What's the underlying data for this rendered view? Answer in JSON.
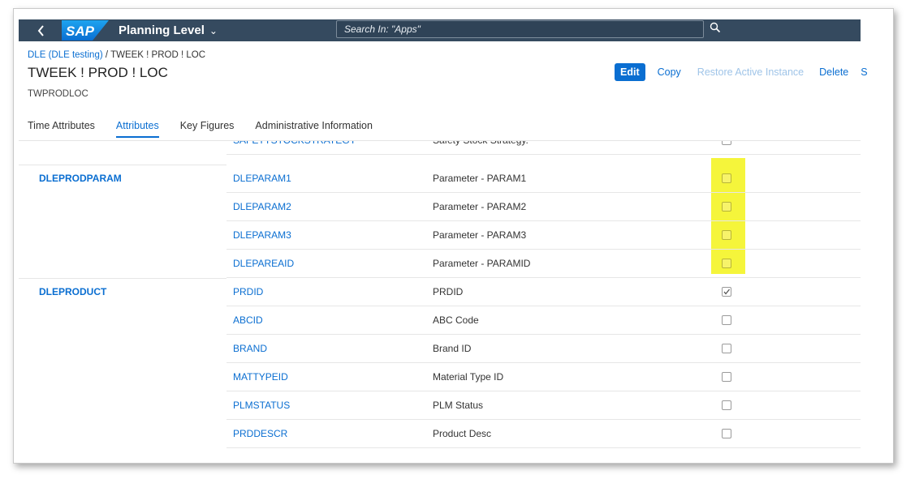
{
  "shell": {
    "back_icon": "chevron-left-icon",
    "logo_text": "SAP",
    "app_title": "Planning Level",
    "app_title_chevron": "chevron-down-icon",
    "search_placeholder": "Search In: \"Apps\"",
    "search_icon": "search-icon"
  },
  "header": {
    "breadcrumb_link": "DLE (DLE testing)",
    "breadcrumb_separator": " / ",
    "breadcrumb_current": "TWEEK ! PROD ! LOC",
    "title": "TWEEK ! PROD ! LOC",
    "subtitle": "TWPRODLOC"
  },
  "actions": {
    "edit": "Edit",
    "copy": "Copy",
    "restore": "Restore Active Instance",
    "delete": "Delete",
    "overflow_partial": "S"
  },
  "tabs": [
    {
      "label": "Time Attributes",
      "active": false
    },
    {
      "label": "Attributes",
      "active": true
    },
    {
      "label": "Key Figures",
      "active": false
    },
    {
      "label": "Administrative Information",
      "active": false
    }
  ],
  "rows": [
    {
      "group": "",
      "attribute": "SAFETYSTOCKSTRATEGY",
      "description": "Safety Stock Strategy.",
      "checked": false
    },
    {
      "group": "DLEPRODPARAM",
      "attribute": "DLEPARAM1",
      "description": "Parameter - PARAM1",
      "checked": false
    },
    {
      "group": "",
      "attribute": "DLEPARAM2",
      "description": "Parameter - PARAM2",
      "checked": false
    },
    {
      "group": "",
      "attribute": "DLEPARAM3",
      "description": "Parameter - PARAM3",
      "checked": false
    },
    {
      "group": "",
      "attribute": "DLEPAREAID",
      "description": "Parameter - PARAMID",
      "checked": false
    },
    {
      "group": "DLEPRODUCT",
      "attribute": "PRDID",
      "description": "PRDID",
      "checked": true
    },
    {
      "group": "",
      "attribute": "ABCID",
      "description": "ABC Code",
      "checked": false
    },
    {
      "group": "",
      "attribute": "BRAND",
      "description": "Brand ID",
      "checked": false
    },
    {
      "group": "",
      "attribute": "MATTYPEID",
      "description": "Material Type ID",
      "checked": false
    },
    {
      "group": "",
      "attribute": "PLMSTATUS",
      "description": "PLM Status",
      "checked": false
    },
    {
      "group": "",
      "attribute": "PRDDESCR",
      "description": "Product Desc",
      "checked": false
    }
  ],
  "colors": {
    "shell_bar": "#354a5f",
    "link": "#0a6ed1",
    "highlight": "#f4f42a"
  }
}
